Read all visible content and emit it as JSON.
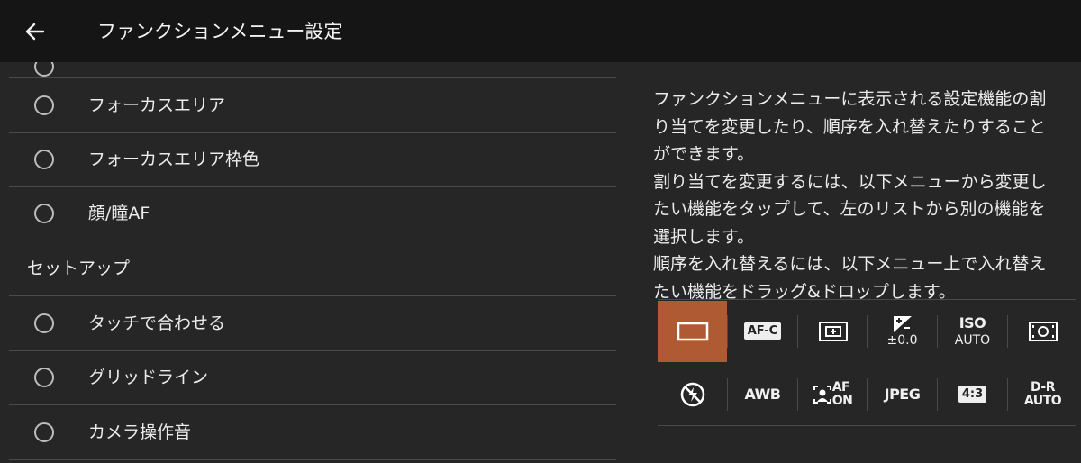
{
  "header": {
    "title": "ファンクションメニュー設定",
    "back_icon": "arrow-left-icon"
  },
  "list": {
    "items": [
      {
        "type": "option",
        "label": "フォーカスエリア"
      },
      {
        "type": "option",
        "label": "フォーカスエリア枠色"
      },
      {
        "type": "option",
        "label": "顔/瞳AF"
      },
      {
        "type": "section",
        "label": "セットアップ"
      },
      {
        "type": "option",
        "label": "タッチで合わせる"
      },
      {
        "type": "option",
        "label": "グリッドライン"
      },
      {
        "type": "option",
        "label": "カメラ操作音"
      }
    ]
  },
  "description": {
    "paragraphs": [
      "ファンクションメニューに表示される設定機能の割り当てを変更したり、順序を入れ替えたりすることができます。",
      "割り当てを変更するには、以下メニューから変更したい機能をタップして、左のリストから別の機能を選択します。",
      "順序を入れ替えるには、以下メニュー上で入れ替えたい機能をドラッグ&ドロップします。"
    ]
  },
  "function_menu": {
    "selected_color": "#b05a33",
    "row1": [
      {
        "icon": "single-shooting-frame-icon",
        "selected": true
      },
      {
        "icon": "af-c-icon",
        "text": "AF-C"
      },
      {
        "icon": "focus-area-wide-icon"
      },
      {
        "icon": "exposure-comp-icon",
        "sub": "±0.0"
      },
      {
        "icon": "iso-icon",
        "text": "ISO",
        "sub": "AUTO"
      },
      {
        "icon": "metering-mode-icon"
      }
    ],
    "row2": [
      {
        "icon": "flash-off-icon"
      },
      {
        "icon": "white-balance-icon",
        "text": "AWB"
      },
      {
        "icon": "face-af-icon",
        "text": "AF",
        "sub": "ON"
      },
      {
        "icon": "file-format-icon",
        "text": "JPEG"
      },
      {
        "icon": "aspect-ratio-icon",
        "text": "4:3"
      },
      {
        "icon": "dro-icon",
        "text": "D-R",
        "sub": "AUTO"
      }
    ]
  }
}
